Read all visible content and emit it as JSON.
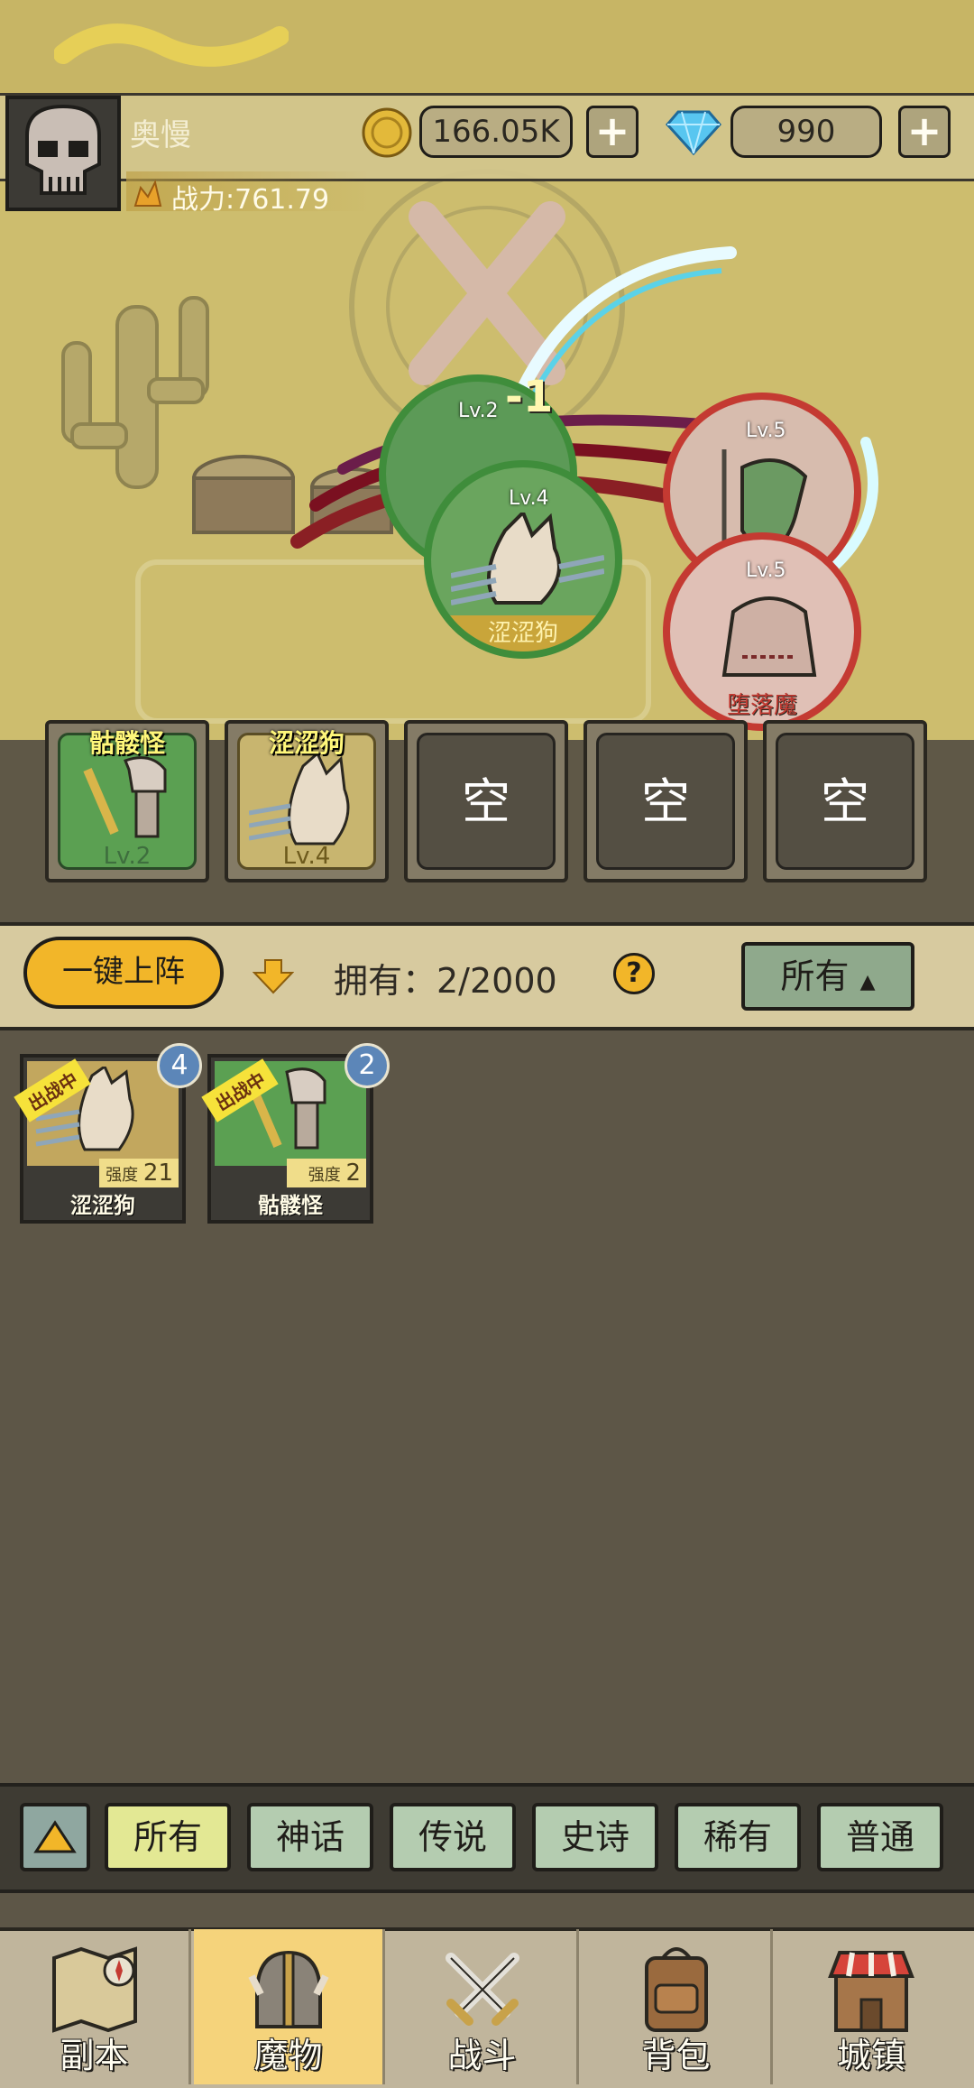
{
  "player": {
    "name": "奥慢",
    "power_label": "战力:761.79",
    "gold": "166.05K",
    "diamonds": "990"
  },
  "battle": {
    "damage_popup": "-1",
    "allies": [
      {
        "level": "Lv.2",
        "name": ""
      },
      {
        "level": "Lv.4",
        "name": "涩涩狗"
      }
    ],
    "enemies": [
      {
        "level": "Lv.5",
        "name": ""
      },
      {
        "level": "Lv.5",
        "name": "堕落魔"
      }
    ]
  },
  "squad_slots": [
    {
      "name": "骷髅怪",
      "level": "Lv.2",
      "empty_label": ""
    },
    {
      "name": "涩涩狗",
      "level": "Lv.4",
      "empty_label": ""
    },
    {
      "name": "",
      "level": "",
      "empty_label": "空"
    },
    {
      "name": "",
      "level": "",
      "empty_label": "空"
    },
    {
      "name": "",
      "level": "",
      "empty_label": "空"
    }
  ],
  "toolbar": {
    "deploy_label": "一键上阵",
    "owned_label": "拥有：2/2000",
    "help": "?",
    "sort_label": "所有"
  },
  "monsters": [
    {
      "name": "涩涩狗",
      "strength_label": "强度",
      "strength": "21",
      "count": "4",
      "tag": "出战中"
    },
    {
      "name": "骷髅怪",
      "strength_label": "强度",
      "strength": "2",
      "count": "2",
      "tag": "出战中"
    }
  ],
  "rarity_tabs": [
    "所有",
    "神话",
    "传说",
    "史诗",
    "稀有",
    "普通"
  ],
  "nav": [
    "副本",
    "魔物",
    "战斗",
    "背包",
    "城镇"
  ],
  "colors": {
    "accent": "#f2b629",
    "ally_ring": "#3f8d3b",
    "enemy_ring": "#c43a32",
    "active_nav": "#f5d37b"
  }
}
